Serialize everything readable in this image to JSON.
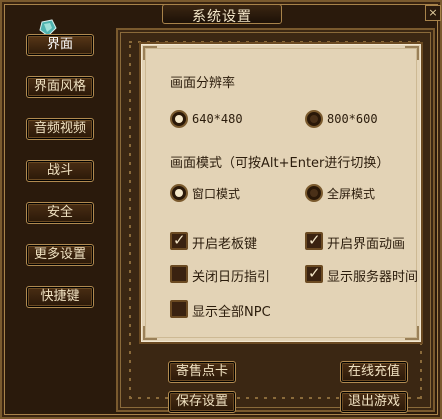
{
  "window": {
    "title": "系统设置",
    "close_label": "×"
  },
  "sidebar": {
    "items": [
      {
        "label": "界面"
      },
      {
        "label": "界面风格"
      },
      {
        "label": "音频视频"
      },
      {
        "label": "战斗"
      },
      {
        "label": "安全"
      },
      {
        "label": "更多设置"
      },
      {
        "label": "快捷键"
      }
    ]
  },
  "settings": {
    "resolution_heading": "画面分辨率",
    "resolution_options": [
      {
        "label": "640*480",
        "selected": true
      },
      {
        "label": "800*600",
        "selected": false
      }
    ],
    "display_mode_heading": "画面模式（可按Alt+Enter进行切换）",
    "display_mode_options": [
      {
        "label": "窗口模式",
        "selected": true
      },
      {
        "label": "全屏模式",
        "selected": false
      }
    ],
    "checkboxes": [
      {
        "label": "开启老板键",
        "checked": true
      },
      {
        "label": "开启界面动画",
        "checked": true
      },
      {
        "label": "关闭日历指引",
        "checked": false
      },
      {
        "label": "显示服务器时间",
        "checked": true
      },
      {
        "label": "显示全部NPC",
        "checked": false
      }
    ]
  },
  "footer": {
    "sell_points": "寄售点卡",
    "recharge": "在线充值",
    "save": "保存设置",
    "exit": "退出游戏"
  },
  "colors": {
    "frame": "#2a1a0c",
    "panel_fill": "#e3d3b6",
    "button_text": "#f0e2c2",
    "border_gold": "#a8834a"
  }
}
